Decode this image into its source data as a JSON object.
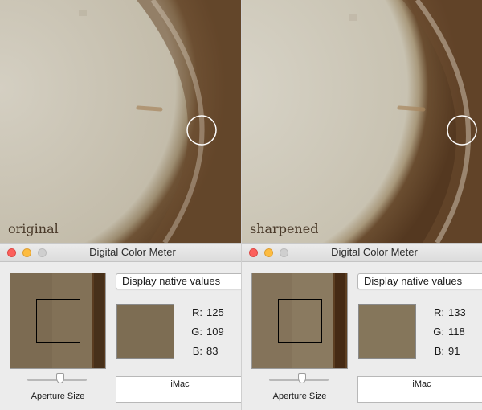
{
  "panels": [
    {
      "caption": "original",
      "window_title": "Digital Color Meter",
      "display_mode": "Display native values",
      "rgb": {
        "r_label": "R:",
        "r": "125",
        "g_label": "G:",
        "g": "109",
        "b_label": "B:",
        "b": "83"
      },
      "swatch_color": "#7d6d53",
      "aperture_label": "Aperture Size",
      "display_name": "iMac"
    },
    {
      "caption": "sharpened",
      "window_title": "Digital Color Meter",
      "display_mode": "Display native values",
      "rgb": {
        "r_label": "R:",
        "r": "133",
        "g_label": "G:",
        "g": "118",
        "b_label": "B:",
        "b": "91"
      },
      "swatch_color": "#85765b",
      "aperture_label": "Aperture Size",
      "display_name": "iMac"
    }
  ],
  "colors": {
    "plate_light": "#cdc8bb",
    "rim_brown": "#6a4f33",
    "preview_dark": "#4a2f17",
    "traffic_close": "#fc605c",
    "traffic_minimize": "#fdbc40",
    "traffic_zoom_disabled": "#cfcfcf"
  },
  "icons": [
    "close-icon",
    "minimize-icon",
    "zoom-icon",
    "aperture-slider-knob"
  ]
}
